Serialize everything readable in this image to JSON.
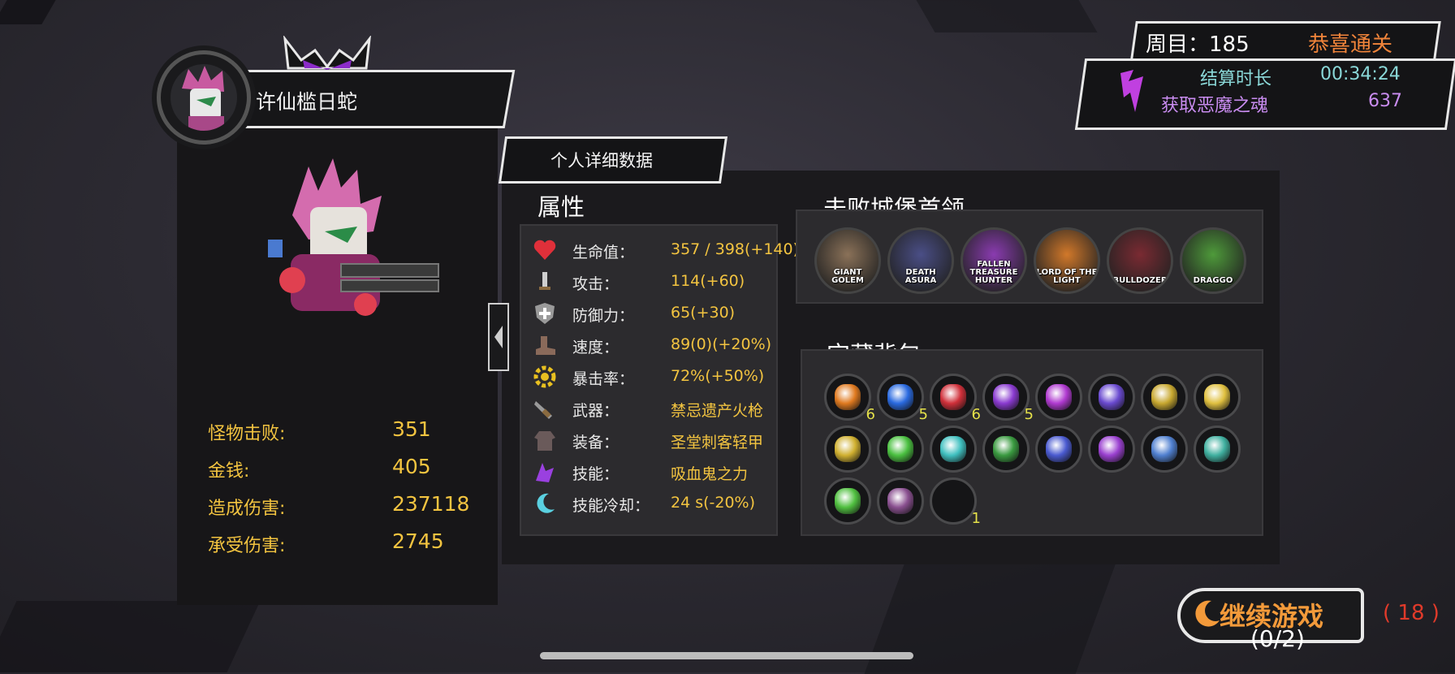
{
  "player": {
    "name": "许仙槛日蛇"
  },
  "tab_label": "个人详细数据",
  "left_stats": [
    {
      "label": "怪物击败:",
      "value": "351"
    },
    {
      "label": "金钱:",
      "value": "405"
    },
    {
      "label": "造成伤害:",
      "value": "237118"
    },
    {
      "label": "承受伤害:",
      "value": "2745"
    }
  ],
  "attributes": {
    "title": "属性",
    "rows": [
      {
        "icon": "heart-icon",
        "label": "生命值：",
        "value": "357 / 398(+140)"
      },
      {
        "icon": "sword-icon",
        "label": "攻击：",
        "value": "114(+60)"
      },
      {
        "icon": "shield-icon",
        "label": "防御力：",
        "value": "65(+30)"
      },
      {
        "icon": "boot-icon",
        "label": "速度：",
        "value": "89(0)(+20%)"
      },
      {
        "icon": "gear-icon",
        "label": "暴击率：",
        "value": "72%(+50%)"
      },
      {
        "icon": "weapon-icon",
        "label": "武器：",
        "value": "禁忌遗产火枪"
      },
      {
        "icon": "armor-icon",
        "label": "装备：",
        "value": "圣堂刺客轻甲"
      },
      {
        "icon": "skill-icon",
        "label": "技能：",
        "value": "吸血鬼之力"
      },
      {
        "icon": "moon-icon",
        "label": "技能冷却：",
        "value": "24 s(-20%)"
      }
    ]
  },
  "bosses": {
    "title": "击败城堡首领",
    "items": [
      {
        "name": "GIANT GOLEM",
        "color": "#8a7158"
      },
      {
        "name": "DEATH ASURA",
        "color": "#4a4e86"
      },
      {
        "name": "FALLEN TREASURE HUNTER",
        "color": "#8a3bb0"
      },
      {
        "name": "LORD OF THE LIGHT",
        "color": "#d1782a"
      },
      {
        "name": "BULLDOZER",
        "color": "#7a2a32"
      },
      {
        "name": "DRAGGO",
        "color": "#4e9a3a"
      }
    ]
  },
  "treasure": {
    "title": "宝藏背包",
    "items": [
      {
        "color": "#e07a20",
        "count": "6"
      },
      {
        "color": "#2a6ae0",
        "count": "5"
      },
      {
        "color": "#d0303a",
        "count": "6"
      },
      {
        "color": "#8a3ad0",
        "count": "5"
      },
      {
        "color": "#b03ad0",
        "count": ""
      },
      {
        "color": "#6a4ad0",
        "count": ""
      },
      {
        "color": "#c8a830",
        "count": ""
      },
      {
        "color": "#e0c040",
        "count": ""
      },
      {
        "color": "#d0b030",
        "count": ""
      },
      {
        "color": "#4ac040",
        "count": ""
      },
      {
        "color": "#40c0c0",
        "count": ""
      },
      {
        "color": "#3a9a40",
        "count": ""
      },
      {
        "color": "#4a5ad0",
        "count": ""
      },
      {
        "color": "#9a40d0",
        "count": ""
      },
      {
        "color": "#5080d0",
        "count": ""
      },
      {
        "color": "#40b0a0",
        "count": ""
      },
      {
        "color": "#50c040",
        "count": ""
      },
      {
        "color": "#8a5090",
        "count": ""
      },
      {
        "color": "#151517",
        "count": "1"
      }
    ]
  },
  "run": {
    "round_label": "周目：185",
    "clear_label": "恭喜通关",
    "duration_label": "结算时长",
    "duration_value": "00:34:24",
    "soul_label": "获取恶魔之魂",
    "soul_value": "637"
  },
  "continue": {
    "label": "继续游戏",
    "count": "(0/2)",
    "timer": "( 18 )"
  },
  "colors": {
    "accent_gold": "#f3c440",
    "soul_purple": "#c98cf0",
    "continue_orange": "#f39a3a"
  }
}
